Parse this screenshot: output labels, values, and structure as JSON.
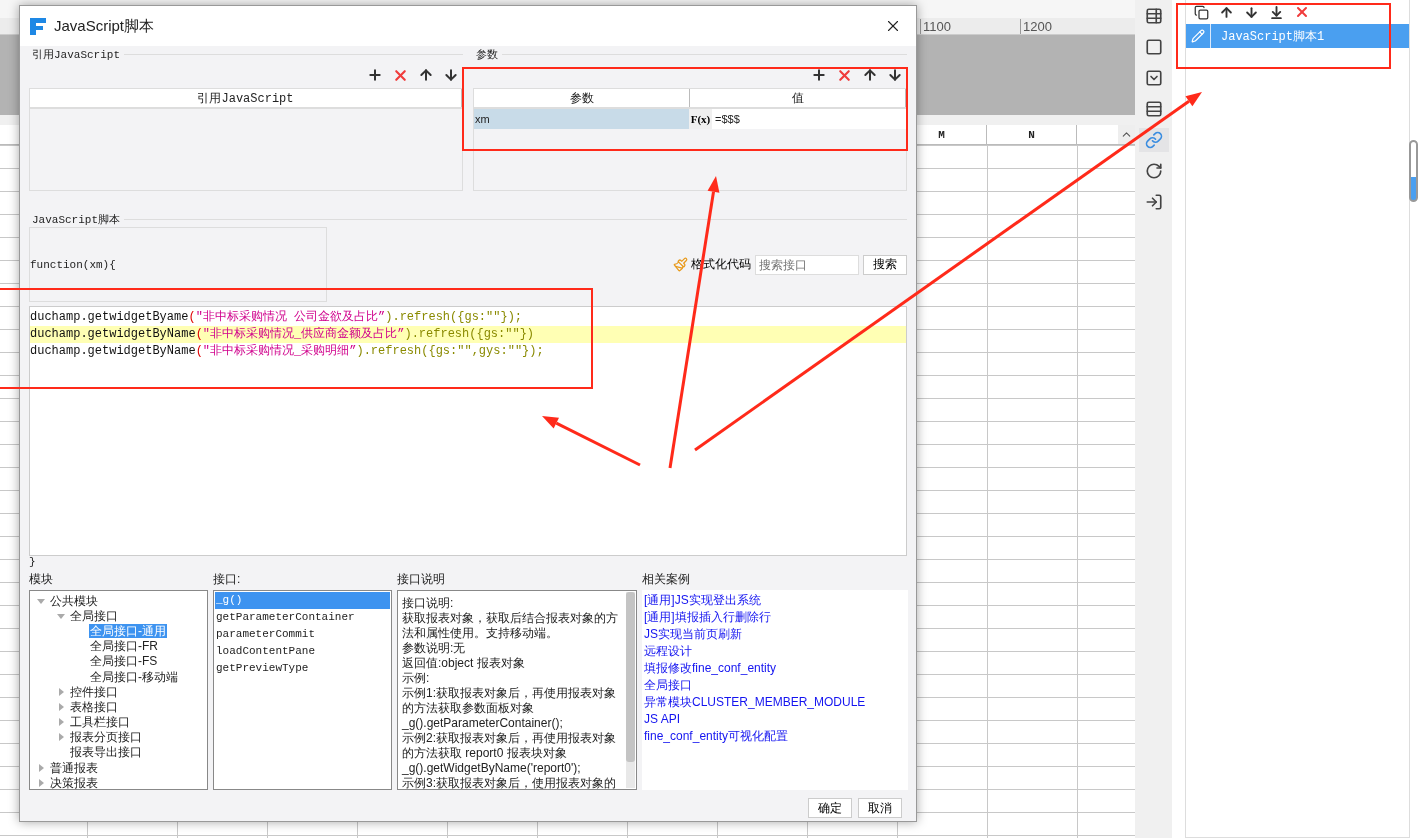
{
  "ruler": [
    "1100",
    "1200"
  ],
  "columns": [
    "M",
    "N"
  ],
  "dialog": {
    "title": "JavaScript脚本",
    "imports": {
      "legend": "引用JavaScript",
      "column": "引用JavaScript"
    },
    "params": {
      "legend": "参数",
      "columns": [
        "参数",
        "值"
      ],
      "rows": [
        {
          "name": "xm",
          "formula": "F(x)",
          "value": "=$$$",
          "selected": true
        }
      ]
    },
    "script": {
      "legend": "JavaScript脚本",
      "header": "function(xm){",
      "format_label": "格式化代码",
      "search_placeholder": "搜索接口",
      "search_button": "搜索",
      "footer": "}",
      "lines": [
        {
          "highlighted": false,
          "tokens": [
            {
              "kind": "plain",
              "text": "duchamp.getwidgetByame"
            },
            {
              "kind": "paren",
              "text": "("
            },
            {
              "kind": "string",
              "text": "\"非中标采购情况 公司金欲及占比”"
            },
            {
              "kind": "call",
              "text": ").refresh({gs:\"\"});"
            }
          ]
        },
        {
          "highlighted": true,
          "tokens": [
            {
              "kind": "plain",
              "text": "duchamp.getwidgetByName"
            },
            {
              "kind": "paren",
              "text": "("
            },
            {
              "kind": "string",
              "text": "\"非中标采购情况_供应商金额及占比”"
            },
            {
              "kind": "call",
              "text": ").refresh({gs:\"\"})"
            }
          ]
        },
        {
          "highlighted": false,
          "tokens": [
            {
              "kind": "plain",
              "text": "duchamp.getwidgetByName"
            },
            {
              "kind": "paren",
              "text": "("
            },
            {
              "kind": "string",
              "text": "\"非中标采购情况_采购明细”"
            },
            {
              "kind": "call",
              "text": ").refresh({gs:\"\",gys:\"\"});"
            }
          ]
        }
      ]
    },
    "modules": {
      "label": "模块",
      "tree": [
        {
          "label": "公共模块",
          "expanded": true,
          "selected": false,
          "children": [
            {
              "label": "全局接口",
              "expanded": true,
              "selected": false,
              "children": [
                {
                  "label": "全局接口-通用",
                  "selected": true
                },
                {
                  "label": "全局接口-FR",
                  "selected": false
                },
                {
                  "label": "全局接口-FS",
                  "selected": false
                },
                {
                  "label": "全局接口-移动端",
                  "selected": false
                }
              ]
            },
            {
              "label": "控件接口",
              "expanded": false,
              "selected": false
            },
            {
              "label": "表格接口",
              "expanded": false,
              "selected": false
            },
            {
              "label": "工具栏接口",
              "expanded": false,
              "selected": false
            },
            {
              "label": "报表分页接口",
              "expanded": false,
              "selected": false
            },
            {
              "label": "报表导出接口",
              "selected": false
            }
          ]
        },
        {
          "label": "普通报表",
          "expanded": false,
          "selected": false
        },
        {
          "label": "决策报表",
          "expanded": false,
          "selected": false
        }
      ]
    },
    "interfaces": {
      "label": "接口:",
      "items": [
        {
          "label": "_g()",
          "selected": true
        },
        {
          "label": "getParameterContainer",
          "selected": false
        },
        {
          "label": "parameterCommit",
          "selected": false
        },
        {
          "label": "loadContentPane",
          "selected": false
        },
        {
          "label": "getPreviewType",
          "selected": false
        }
      ]
    },
    "description": {
      "label": "接口说明",
      "lines": [
        "接口说明:",
        "获取报表对象，获取后结合报表对象的方",
        "法和属性使用。支持移动端。",
        "参数说明:无",
        "返回值:object 报表对象",
        "示例:",
        "示例1:获取报表对象后，再使用报表对象",
        "的方法获取参数面板对象",
        "_g().getParameterContainer();",
        "示例2:获取报表对象后，再使用报表对象",
        "的方法获取 report0 报表块对象",
        "_g().getWidgetByName('report0');",
        "示例3:获取报表对象后，使用报表对象的"
      ]
    },
    "cases": {
      "label": "相关案例",
      "links": [
        "[通用]JS实现登出系统",
        "[通用]填报插入行删除行",
        "JS实现当前页刷新",
        "远程设计",
        "填报修改fine_conf_entity",
        "全局接口",
        "异常模块CLUSTER_MEMBER_MODULE",
        "JS API",
        "fine_conf_entity可视化配置"
      ]
    },
    "buttons": [
      "确定",
      "取消"
    ]
  },
  "side_tools": [
    {
      "kind": "cell-info",
      "selected": false
    },
    {
      "kind": "frame",
      "selected": false
    },
    {
      "kind": "dropdown",
      "selected": false
    },
    {
      "kind": "layout",
      "selected": false
    },
    {
      "kind": "link",
      "selected": true
    },
    {
      "kind": "rotate",
      "selected": false
    },
    {
      "kind": "import",
      "selected": false
    }
  ],
  "script_list": [
    {
      "label": "JavaScript脚本1",
      "selected": true
    }
  ]
}
